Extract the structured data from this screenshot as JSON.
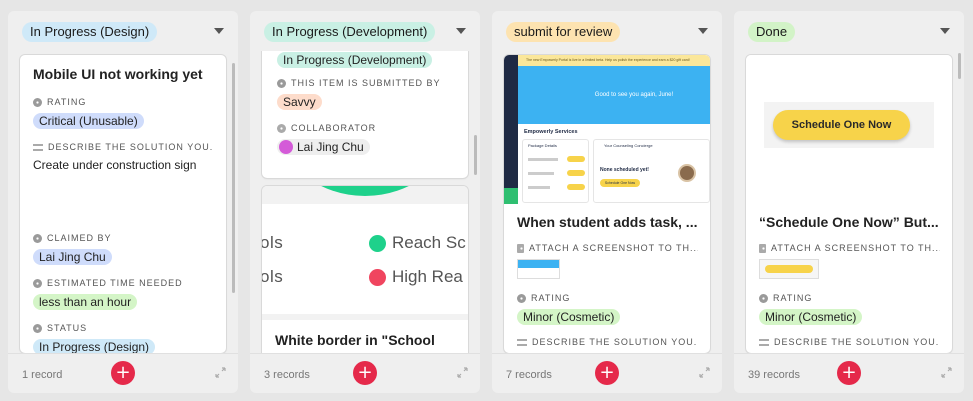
{
  "columns": [
    {
      "title": "In Progress (Design)",
      "color": "#cfe9f8",
      "count": "1 record",
      "card": {
        "title": "Mobile UI not working yet",
        "rating_label": "RATING",
        "rating": "Critical (Unusable)",
        "describe_label": "DESCRIBE THE SOLUTION YOU...",
        "describe": "Create under construction sign",
        "claimed_label": "CLAIMED BY",
        "claimed": "Lai Jing Chu",
        "time_label": "ESTIMATED TIME NEEDED",
        "time": "less than an hour",
        "status_label": "STATUS",
        "status": "In Progress (Design)"
      }
    },
    {
      "title": "In Progress (Development)",
      "color": "#c9f0e4",
      "count": "3 records",
      "card1": {
        "status": "In Progress (Development)",
        "submitted_label": "THIS ITEM IS SUBMITTED BY",
        "submitted": "Savvy",
        "collab_label": "COLLABORATOR",
        "collab": "Lai Jing Chu"
      },
      "card2": {
        "left1": "ols",
        "right1": "Reach Sc",
        "left2": "ols",
        "right2": "High Rea",
        "title": "White border in \"School"
      }
    },
    {
      "title": "submit for review",
      "color": "#fde3b0",
      "count": "7 records",
      "card": {
        "title": "When student adds task, ...",
        "attach_label": "ATTACH A SCREENSHOT TO TH...",
        "rating_label": "RATING",
        "rating": "Minor (Cosmetic)",
        "describe_label": "DESCRIBE THE SOLUTION YOU...",
        "shot": {
          "banner": "The new Empowerly Portal is live in a limited beta. Help us polish the experience and earn a $20 gift card!",
          "welcome": "Good to see you again, June!",
          "services": "Empowerly Services",
          "pkg": "Package Details",
          "concierge": "Your Counseling Concierge",
          "none": "None scheduled yet!",
          "btn": "Schedule One Now"
        }
      }
    },
    {
      "title": "Done",
      "color": "#d2f3c7",
      "count": "39 records",
      "card": {
        "button": "Schedule One Now",
        "title": "“Schedule One Now” But...",
        "attach_label": "ATTACH A SCREENSHOT TO TH...",
        "rating_label": "RATING",
        "rating": "Minor (Cosmetic)",
        "describe_label": "DESCRIBE THE SOLUTION YOU..."
      }
    }
  ],
  "add_label": "+",
  "colors": {
    "critical": "#cfdcfb",
    "person": "#cfdcfb",
    "time": "#d4f5c7",
    "status": "#cfe9f8",
    "savvy": "#fddccb",
    "collab": "#eeeeee",
    "minor": "#d4f5c7",
    "accent": "#e5294a"
  }
}
